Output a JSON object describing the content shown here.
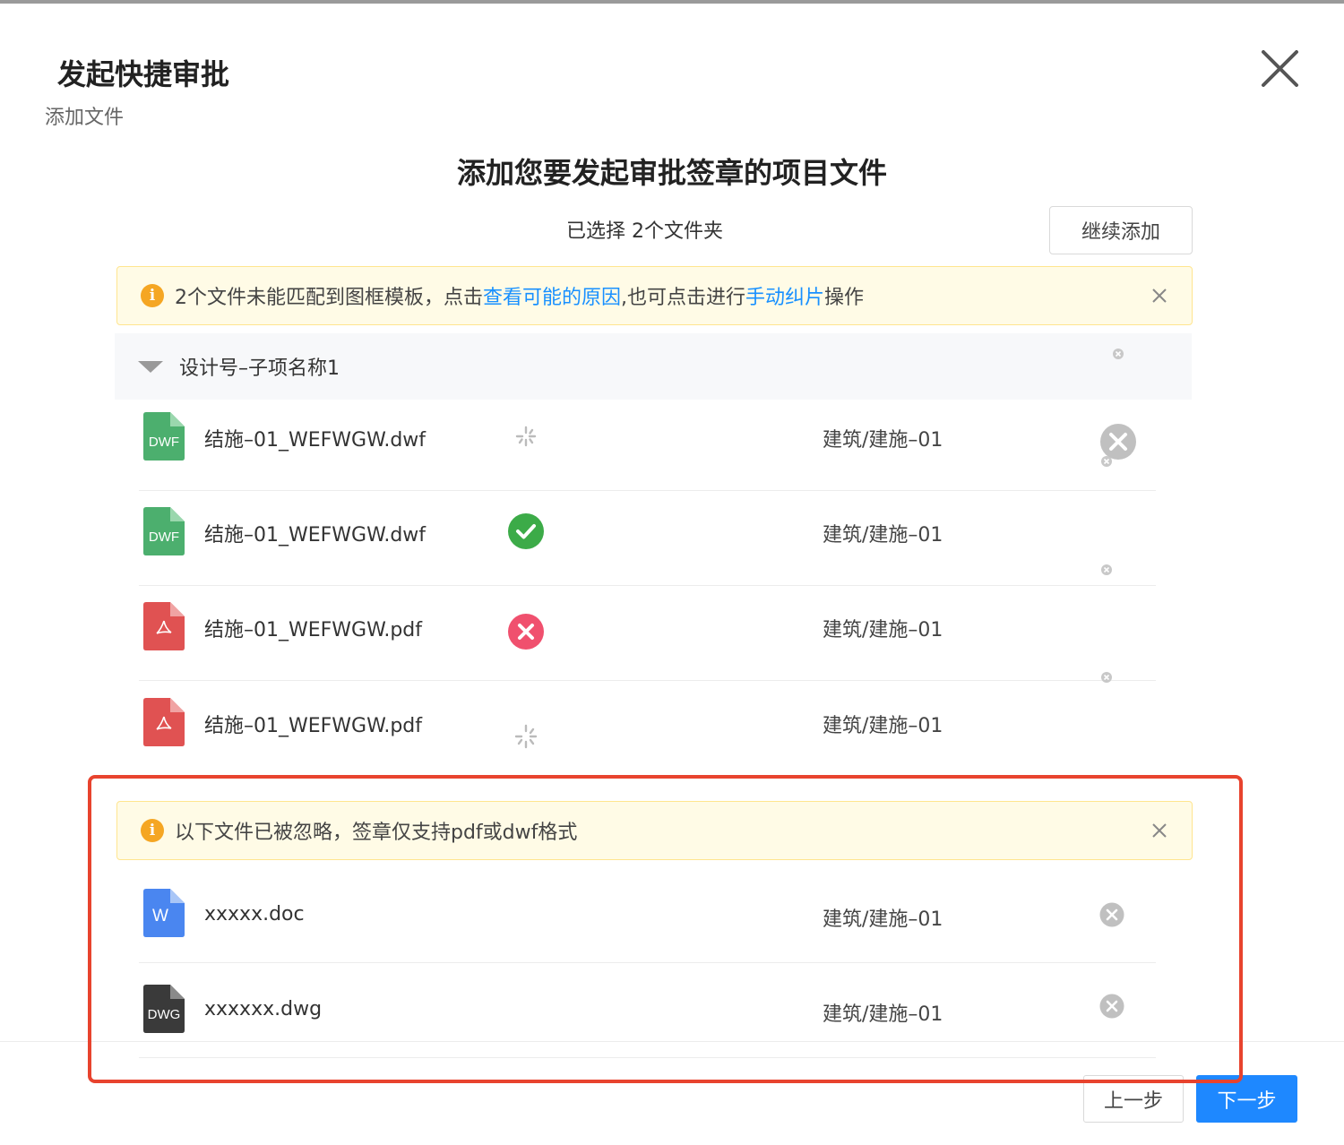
{
  "dialog": {
    "title": "发起快捷审批",
    "step_label": "添加文件",
    "heading": "添加您要发起审批签章的项目文件",
    "selected_info": "已选择 2个文件夹",
    "continue_button": "继续添加"
  },
  "warning_alert": {
    "text_prefix": "2个文件未能匹配到图框模板，点击 ",
    "link1": "查看可能的原因",
    "text_middle": " ,也可点击进行 ",
    "link2": "手动纠片",
    "text_suffix": "操作"
  },
  "group": {
    "name": "设计号–子项名称1"
  },
  "files": [
    {
      "type_label": "DWF",
      "name": "结施–01_WEFWGW.dwf",
      "status": "loading",
      "path": "建筑/建施–01"
    },
    {
      "type_label": "DWF",
      "name": "结施–01_WEFWGW.dwf",
      "status": "success",
      "path": "建筑/建施–01"
    },
    {
      "type_label": "PDF",
      "name": "结施–01_WEFWGW.pdf",
      "status": "error",
      "path": "建筑/建施–01"
    },
    {
      "type_label": "PDF",
      "name": "结施–01_WEFWGW.pdf",
      "status": "loading",
      "path": "建筑/建施–01"
    }
  ],
  "ignored_alert": {
    "text": "以下文件已被忽略，签章仅支持pdf或dwf格式"
  },
  "ignored_files": [
    {
      "type_label": "W",
      "name": "xxxxx.doc",
      "path": "建筑/建施–01"
    },
    {
      "type_label": "DWG",
      "name": "xxxxxx.dwg",
      "path": "建筑/建施–01"
    }
  ],
  "footer": {
    "prev_button": "上一步",
    "next_button": "下一步"
  },
  "colors": {
    "dwf_icon": "#4caf6e",
    "pdf_icon": "#e05252",
    "doc_icon": "#4a86f0",
    "dwg_icon": "#3a3a3a",
    "success": "#3cab48",
    "error": "#f0506e",
    "link": "#1890ff",
    "primary": "#1e88ff",
    "annotation": "#e8432e"
  }
}
